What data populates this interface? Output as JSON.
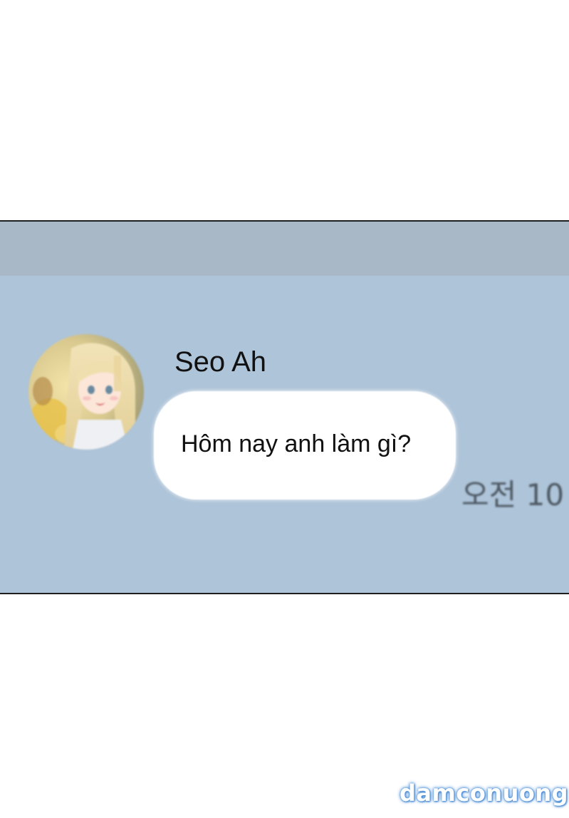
{
  "chat": {
    "sender_name": "Seo Ah",
    "message_text": "Hôm nay anh làm gì?",
    "timestamp": "오전 10"
  },
  "watermark": {
    "text": "damconuong"
  },
  "colors": {
    "panel_background": "#aec4d9",
    "header_strip": "#a8b8c7",
    "bubble": "#ffffff",
    "watermark_glow": "#4a8fd8"
  },
  "icons": {
    "avatar": "profile-avatar-anime-girl"
  }
}
